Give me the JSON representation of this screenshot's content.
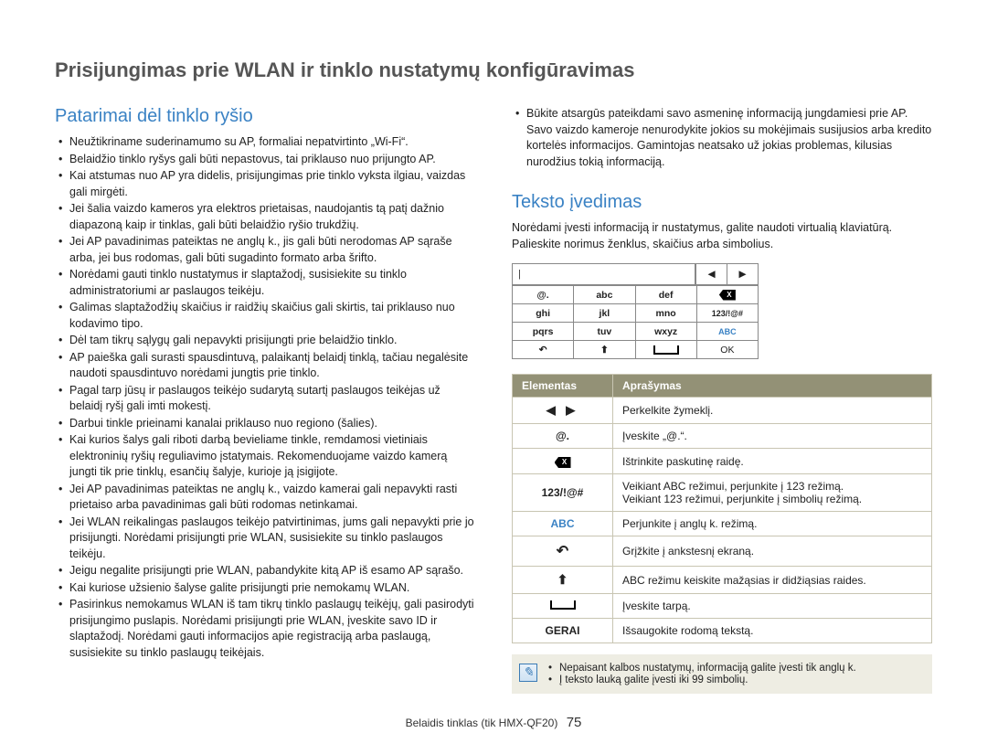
{
  "main_title": "Prisijungimas prie WLAN ir tinklo nustatymų konfigūravimas",
  "left": {
    "heading": "Patarimai dėl tinklo ryšio",
    "items": [
      "Neužtikriname suderinamumo su AP, formaliai nepatvirtinto „Wi-Fi“.",
      "Belaidžio tinklo ryšys gali būti nepastovus, tai priklauso nuo prijungto AP.",
      "Kai atstumas nuo AP yra didelis, prisijungimas prie tinklo vyksta ilgiau, vaizdas gali mirgėti.",
      "Jei šalia vaizdo kameros yra elektros prietaisas, naudojantis tą patį dažnio diapazoną kaip ir tinklas, gali būti belaidžio ryšio trukdžių.",
      "Jei AP pavadinimas pateiktas ne anglų k., jis gali būti nerodomas AP sąraše arba, jei bus rodomas, gali būti sugadinto formato arba šrifto.",
      "Norėdami gauti tinklo nustatymus ir slaptažodį, susisiekite su tinklo administratoriumi ar paslaugos teikėju.",
      "Galimas slaptažodžių skaičius ir raidžių skaičius gali skirtis, tai priklauso nuo kodavimo tipo.",
      "Dėl tam tikrų sąlygų gali nepavykti prisijungti prie belaidžio tinklo.",
      "AP paieška gali surasti spausdintuvą, palaikantį belaidį tinklą, tačiau negalėsite naudoti spausdintuvo norėdami jungtis prie tinklo.",
      "Pagal tarp jūsų ir paslaugos teikėjo sudarytą sutartį paslaugos teikėjas už belaidį ryšį gali imti mokestį.",
      "Darbui tinkle prieinami kanalai priklauso nuo regiono (šalies).",
      "Kai kurios šalys gali riboti darbą bevieliame tinkle, remdamosi vietiniais elektroninių ryšių reguliavimo įstatymais. Rekomenduojame vaizdo kamerą jungti tik prie tinklų, esančių šalyje, kurioje ją įsigijote.",
      "Jei AP pavadinimas pateiktas ne anglų k., vaizdo kamerai gali nepavykti rasti prietaiso arba pavadinimas gali būti rodomas netinkamai.",
      "Jei WLAN reikalingas paslaugos teikėjo patvirtinimas, jums gali nepavykti prie jo prisijungti. Norėdami prisijungti prie WLAN, susisiekite su tinklo paslaugos teikėju.",
      "Jeigu negalite prisijungti prie WLAN, pabandykite kitą AP iš esamo AP sąrašo.",
      "Kai kuriose užsienio šalyse galite prisijungti prie nemokamų WLAN.",
      "Pasirinkus nemokamus WLAN iš tam tikrų tinklo paslaugų teikėjų, gali pasirodyti prisijungimo puslapis. Norėdami prisijungti prie WLAN, įveskite savo ID ir slaptažodį. Norėdami gauti informacijos apie registraciją arba paslaugą, susisiekite su tinklo paslaugų teikėjais."
    ]
  },
  "right_top": {
    "items": [
      "Būkite atsargūs pateikdami savo asmeninę informaciją jungdamiesi prie AP. Savo vaizdo kameroje nenurodykite jokios su mokėjimais susijusios arba kredito kortelės informacijos. Gamintojas neatsako už jokias problemas, kilusias nurodžius tokią informaciją."
    ]
  },
  "text_entry": {
    "heading": "Teksto įvedimas",
    "intro": "Norėdami įvesti informaciją ir nustatymus, galite naudoti virtualią klaviatūrą. Palieskite norimus ženklus, skaičius arba simbolius.",
    "cursor": "|",
    "nav_left": "◀",
    "nav_right": "▶",
    "keys": {
      "r1": [
        "@.",
        "abc",
        "def"
      ],
      "r2": [
        "ghi",
        "jkl",
        "mno",
        "123/!@#"
      ],
      "r3": [
        "pqrs",
        "tuv",
        "wxyz",
        "ABC"
      ],
      "r4_back": "↶",
      "r4_shift": "⬆",
      "r4_ok": "OK"
    }
  },
  "table": {
    "head_elem": "Elementas",
    "head_desc": "Aprašymas",
    "rows": [
      {
        "elem_type": "arrows",
        "elem": "◀  ▶",
        "desc": "Perkelkite žymeklį."
      },
      {
        "elem_type": "text",
        "elem": "@.",
        "desc": "Įveskite „@.“."
      },
      {
        "elem_type": "bksp",
        "elem": "X",
        "desc": "Ištrinkite paskutinę raidę."
      },
      {
        "elem_type": "text",
        "elem": "123/!@#",
        "desc": "Veikiant ABC režimui, perjunkite į 123 režimą.\nVeikiant 123 režimui, perjunkite į simbolių režimą."
      },
      {
        "elem_type": "abc",
        "elem": "ABC",
        "desc": "Perjunkite į anglų k. režimą."
      },
      {
        "elem_type": "back",
        "elem": "↶",
        "desc": "Grįžkite į ankstesnį ekraną."
      },
      {
        "elem_type": "shift",
        "elem": "⬆",
        "desc": "ABC režimu keiskite mažąsias ir didžiąsias raides."
      },
      {
        "elem_type": "space",
        "elem": "space",
        "desc": "Įveskite tarpą."
      },
      {
        "elem_type": "gerai",
        "elem": "GERAI",
        "desc": "Išsaugokite rodomą tekstą."
      }
    ]
  },
  "note": {
    "icon": "✎",
    "items": [
      "Nepaisant kalbos nustatymų, informaciją galite įvesti tik anglų k.",
      "Į teksto lauką galite įvesti iki 99 simbolių."
    ]
  },
  "footer": {
    "text": "Belaidis tinklas (tik HMX-QF20)",
    "page": "75"
  }
}
